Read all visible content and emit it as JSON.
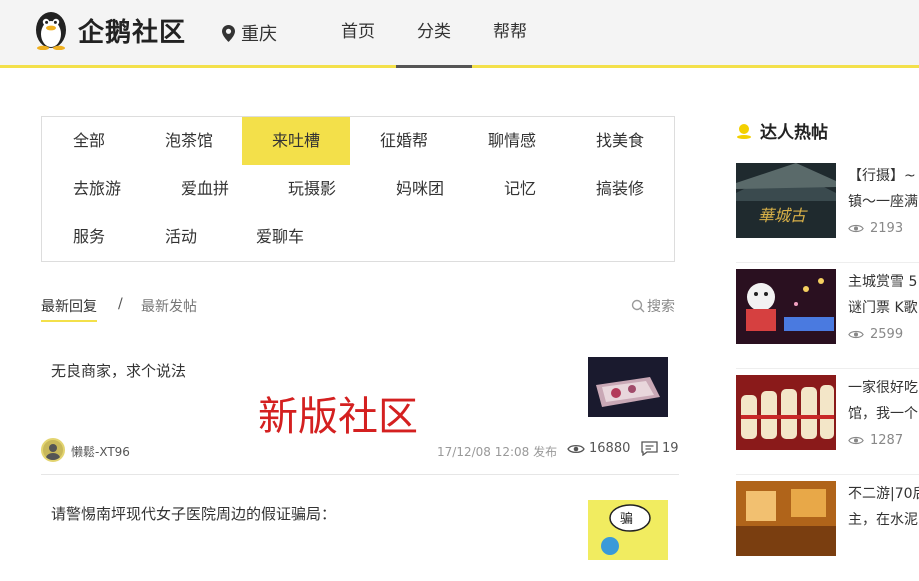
{
  "header": {
    "brand": "企鹅社区",
    "location": "重庆",
    "nav": [
      {
        "label": "首页"
      },
      {
        "label": "分类"
      },
      {
        "label": "帮帮"
      }
    ]
  },
  "categories": [
    {
      "label": "全部"
    },
    {
      "label": "泡茶馆"
    },
    {
      "label": "来吐槽"
    },
    {
      "label": "征婚帮"
    },
    {
      "label": "聊情感"
    },
    {
      "label": "找美食"
    },
    {
      "label": "去旅游"
    },
    {
      "label": "爱血拼"
    },
    {
      "label": "玩摄影"
    },
    {
      "label": "妈咪团"
    },
    {
      "label": "记忆"
    },
    {
      "label": "搞装修"
    },
    {
      "label": "服务"
    },
    {
      "label": "活动"
    },
    {
      "label": "爱聊车"
    }
  ],
  "tabs": {
    "latest_reply": "最新回复",
    "separator": "/",
    "latest_post": "最新发帖",
    "search": "搜索"
  },
  "promo": "新版社区",
  "posts": [
    {
      "title": "无良商家，求个说法",
      "author": "懒鬆-XT96",
      "time": "17/12/08 12:08 发布",
      "views": "16880",
      "comments": "19"
    },
    {
      "title": "请警惕南坪现代女子医院周边的假证骗局："
    }
  ],
  "sidebar": {
    "title": "达人热帖",
    "items": [
      {
        "line1": "【行摄】~",
        "line2": "镇～一座满",
        "views": "2193"
      },
      {
        "line1": "主城赏雪 5",
        "line2": "谜门票 K歌",
        "views": "2599"
      },
      {
        "line1": "一家很好吃",
        "line2": "馆，我一个",
        "views": "1287"
      },
      {
        "line1": "不二游|70后",
        "line2": "主，在水泥",
        "views": ""
      }
    ]
  },
  "colors": {
    "accent": "#f3e04a",
    "promo": "#d42020"
  }
}
